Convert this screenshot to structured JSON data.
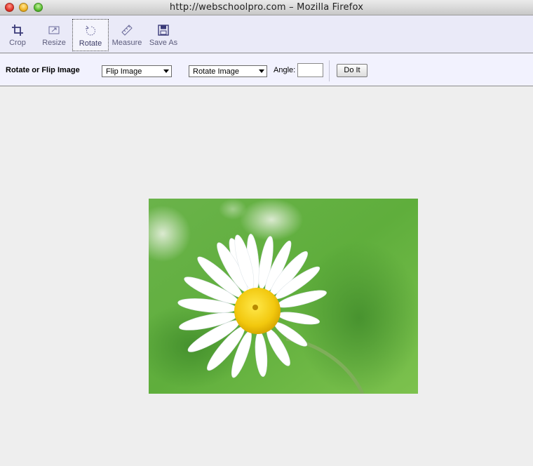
{
  "window": {
    "title": "http://webschoolpro.com – Mozilla Firefox"
  },
  "toolbar": {
    "tools": [
      {
        "label": "Crop",
        "icon": "crop-icon",
        "active": false
      },
      {
        "label": "Resize",
        "icon": "resize-icon",
        "active": false
      },
      {
        "label": "Rotate",
        "icon": "rotate-icon",
        "active": true
      },
      {
        "label": "Measure",
        "icon": "ruler-icon",
        "active": false
      },
      {
        "label": "Save As",
        "icon": "floppy-disk-icon",
        "active": false
      }
    ]
  },
  "options": {
    "title": "Rotate or Flip Image",
    "flip_select": "Flip Image",
    "rotate_select": "Rotate Image",
    "angle_label": "Angle:",
    "angle_value": "",
    "do_it_label": "Do It"
  },
  "canvas": {
    "image_subject": "white daisy flower on green background"
  },
  "colors": {
    "toolbar_bg": "#eaeaf8",
    "options_bg": "#f2f2fe",
    "canvas_bg": "#eeeeee",
    "tool_label": "#5c5c7c"
  }
}
